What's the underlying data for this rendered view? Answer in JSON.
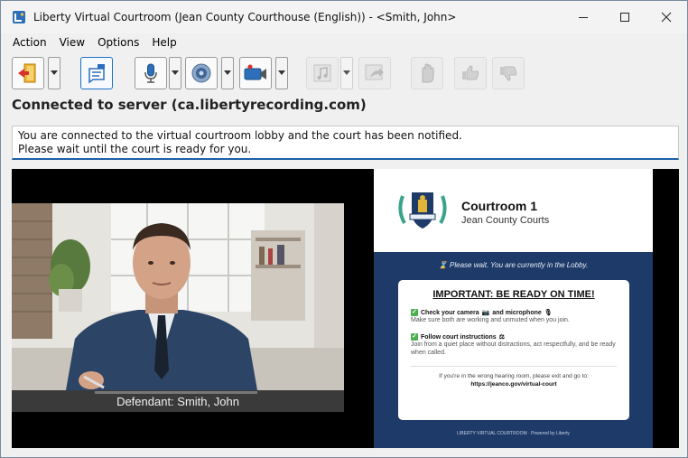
{
  "window": {
    "title": "Liberty Virtual Courtroom (Jean County Courthouse (English)) - <Smith, John>"
  },
  "menu": {
    "items": [
      "Action",
      "View",
      "Options",
      "Help"
    ]
  },
  "toolbar": {
    "buttons": [
      {
        "icon": "exit-door-icon",
        "enabled": true
      },
      {
        "icon": "note-icon",
        "enabled": true
      },
      {
        "icon": "microphone-icon",
        "enabled": true
      },
      {
        "icon": "speaker-icon",
        "enabled": true
      },
      {
        "icon": "camera-icon",
        "enabled": true
      },
      {
        "icon": "music-note-icon",
        "enabled": false
      },
      {
        "icon": "forward-icon",
        "enabled": false
      },
      {
        "icon": "raise-hand-icon",
        "enabled": false
      },
      {
        "icon": "thumbs-up-icon",
        "enabled": false
      },
      {
        "icon": "thumbs-down-icon",
        "enabled": false
      }
    ]
  },
  "status": {
    "connection": "Connected to server (ca.libertyrecording.com)"
  },
  "message": {
    "line1": "You are connected to the virtual courtroom lobby and the court has been notified.",
    "line2": "Please wait until the court is ready for you."
  },
  "camera": {
    "caption": "Defendant: Smith, John"
  },
  "panel": {
    "court_name": "Courtroom 1",
    "court_sub": "Jean County Courts",
    "lobby_notice": "Please wait. You are currently in the Lobby.",
    "card_title": "IMPORTANT: BE READY ON TIME!",
    "item1_head_a": "Check your camera",
    "item1_head_b": "and microphone",
    "item1_body": "Make sure both are working and unmuted when you join.",
    "item2_head": "Follow court instructions",
    "item2_body": "Join from a quiet place without distractions, act respectfully, and be ready when called.",
    "foot_line1": "If you're in the wrong hearing room, please exit and go to:",
    "foot_link": "https://jeanco.gov/virtual-court",
    "footer": "LIBERTY VIRTUAL COURTROOM · Powered by Liberty"
  },
  "colors": {
    "panel_bg": "#1d3a68",
    "accent": "#1e5fa8",
    "check_green": "#4caf50"
  }
}
